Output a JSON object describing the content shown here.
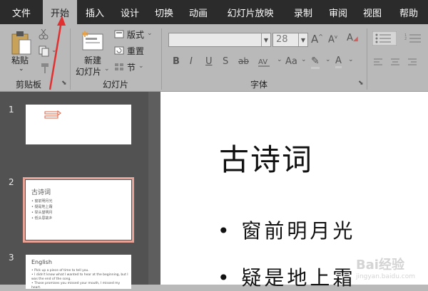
{
  "menu": {
    "tabs": [
      {
        "label": "文件"
      },
      {
        "label": "开始"
      },
      {
        "label": "插入"
      },
      {
        "label": "设计"
      },
      {
        "label": "切换"
      },
      {
        "label": "动画"
      },
      {
        "label": "幻灯片放映"
      },
      {
        "label": "录制"
      },
      {
        "label": "审阅"
      },
      {
        "label": "视图"
      },
      {
        "label": "帮助"
      }
    ],
    "active_index": 1
  },
  "ribbon": {
    "clipboard": {
      "paste_label": "粘贴",
      "group_label": "剪贴板"
    },
    "slides": {
      "new_slide_line1": "新建",
      "new_slide_line2": "幻灯片",
      "layout_label": "版式",
      "reset_label": "重置",
      "section_label": "节",
      "group_label": "幻灯片"
    },
    "font": {
      "font_name": "",
      "font_size": "28",
      "group_label": "字体",
      "bold_label": "B",
      "italic_label": "I",
      "underline_label": "U",
      "strike_label": "S",
      "spacing_label": "ab",
      "size_label": "Aa",
      "color_label": "A"
    }
  },
  "slides_pane": {
    "slides": [
      {
        "number": "1"
      },
      {
        "number": "2",
        "title": "古诗词",
        "lines": [
          "窗前明月光",
          "疑是地上霜",
          "举头望明月",
          "低头思故乡"
        ]
      },
      {
        "number": "3",
        "title": "English",
        "lines": [
          "Pick up a piece of time to tell you.",
          "I didn't know what I wanted to hear at the beginning, but I",
          "was the end of the song.",
          "Those promises you missed your mouth, I missed my heart."
        ]
      }
    ]
  },
  "canvas": {
    "title": "古诗词",
    "bullets": [
      "窗前明月光",
      "疑是地上霜"
    ]
  },
  "annotation": {
    "color": "#e03030"
  },
  "watermark": {
    "text": "Bai经验",
    "sub": "jingyan.baidu.com"
  }
}
